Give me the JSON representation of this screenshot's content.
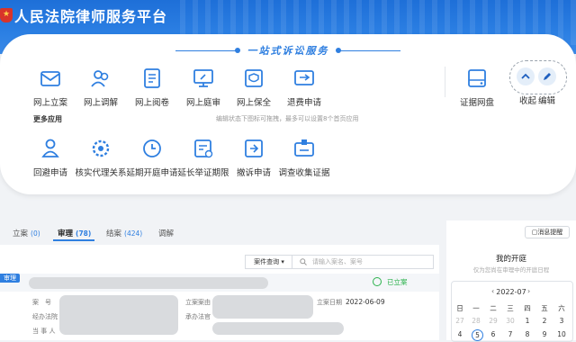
{
  "header": {
    "title": "人民法院律师服务平台"
  },
  "banner": {
    "text": "一站式诉讼服务"
  },
  "services_row1": [
    {
      "label": "网上立案",
      "icon": "envelope-icon"
    },
    {
      "label": "网上调解",
      "icon": "people-icon"
    },
    {
      "label": "网上阅卷",
      "icon": "document-icon"
    },
    {
      "label": "网上庭审",
      "icon": "monitor-icon"
    },
    {
      "label": "网上保全",
      "icon": "shield-icon"
    },
    {
      "label": "退费申请",
      "icon": "refund-icon"
    }
  ],
  "evidence_drive": {
    "label": "证据网盘",
    "icon": "drive-icon"
  },
  "controls": {
    "collapse_label": "收起",
    "edit_label": "编辑"
  },
  "more": {
    "title": "更多应用",
    "hint": "编辑状态下图标可拖拽，最多可以设置8个首页应用"
  },
  "services_row2": [
    {
      "label": "回避申请",
      "icon": "person-icon"
    },
    {
      "label": "核实代理关系",
      "icon": "gear-person-icon"
    },
    {
      "label": "延期开庭申请",
      "icon": "clock-icon"
    },
    {
      "label": "延长举证期限",
      "icon": "calendar-doc-icon"
    },
    {
      "label": "撤诉申请",
      "icon": "withdraw-icon"
    },
    {
      "label": "调查收集证据",
      "icon": "collect-icon"
    }
  ],
  "tabs": [
    {
      "label": "立案",
      "count": "(0)"
    },
    {
      "label": "审理",
      "count": "(78)"
    },
    {
      "label": "结案",
      "count": "(424)"
    },
    {
      "label": "调解",
      "count": ""
    }
  ],
  "case_query": {
    "button": "案件查询 ▾",
    "placeholder": "请输入案名、案号"
  },
  "case": {
    "tag": "审理",
    "status": "已立案",
    "labels": {
      "case_no": "案　号",
      "court": "经办法院",
      "party": "当 事 人",
      "cause": "立案案由",
      "judge": "承办法官",
      "filed_date": "立案日期"
    },
    "filed_date": "2022-06-09"
  },
  "sidebar": {
    "reminder_button": "消息提醒",
    "my_court_title": "我的开庭",
    "my_court_sub": "仅为您尚在审理中的开庭日程",
    "calendar": {
      "month": "2022-07",
      "prev": "‹",
      "next": "›",
      "weekdays": [
        "日",
        "一",
        "二",
        "三",
        "四",
        "五",
        "六"
      ],
      "row1": [
        "27",
        "28",
        "29",
        "30",
        "1",
        "2",
        "3"
      ],
      "row2": [
        "4",
        "5",
        "6",
        "7",
        "8",
        "9",
        "10"
      ],
      "today": "5"
    }
  }
}
